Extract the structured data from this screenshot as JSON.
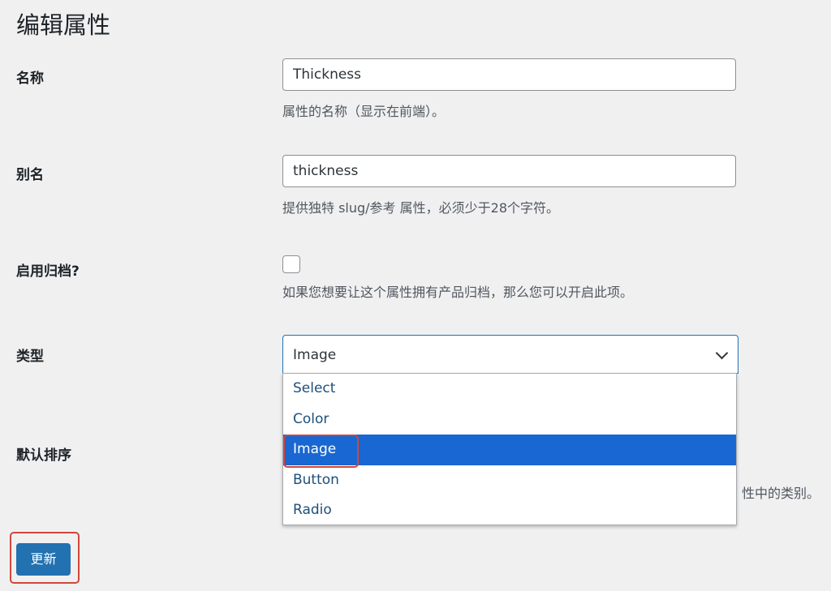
{
  "page_title": "编辑属性",
  "fields": {
    "name": {
      "label": "名称",
      "value": "Thickness",
      "description": "属性的名称（显示在前端）。"
    },
    "slug": {
      "label": "别名",
      "value": "thickness",
      "description": "提供独特 slug/参考 属性，必须少于28个字符。"
    },
    "archives": {
      "label": "启用归档?",
      "checked": false,
      "description": "如果您想要让这个属性拥有产品归档，那么您可以开启此项。"
    },
    "type": {
      "label": "类型",
      "selected": "Image",
      "options": [
        "Select",
        "Color",
        "Image",
        "Button",
        "Radio"
      ]
    },
    "order": {
      "label": "默认排序",
      "description_visible": "性中的类别。"
    }
  },
  "update_button": "更新",
  "colors": {
    "accent": "#2271b1",
    "highlight": "#1967d2",
    "annotation": "#d0473a"
  }
}
